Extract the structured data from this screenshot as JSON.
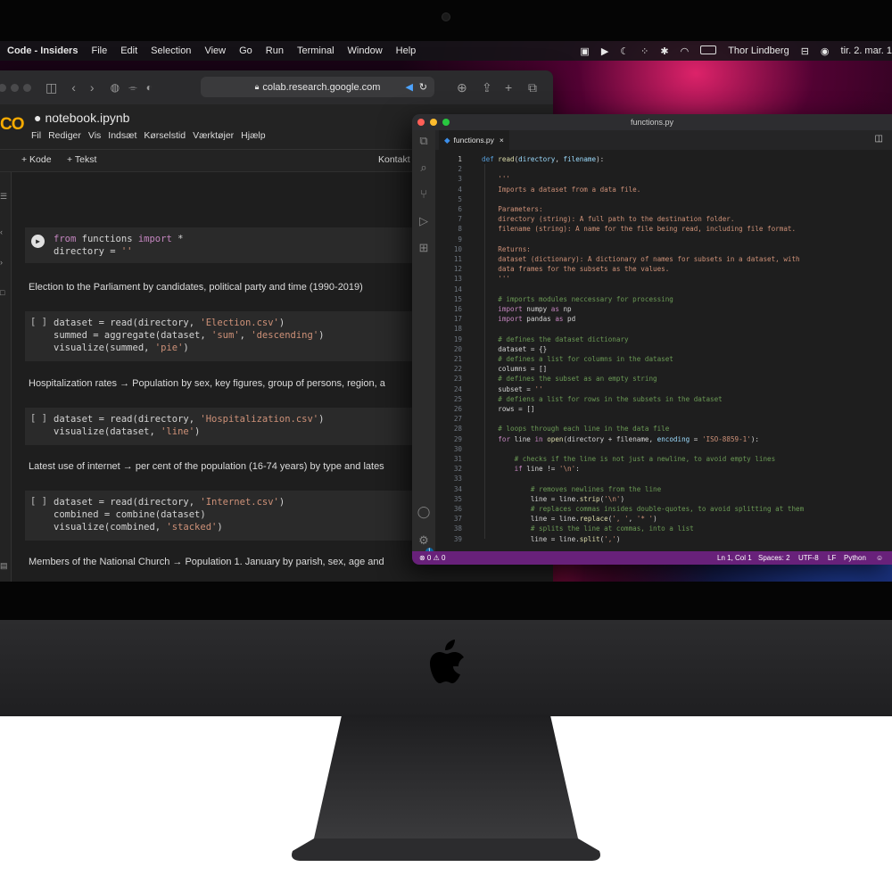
{
  "menubar": {
    "app_name": "Code - Insiders",
    "items": [
      "File",
      "Edit",
      "Selection",
      "View",
      "Go",
      "Run",
      "Terminal",
      "Window",
      "Help"
    ],
    "user": "Thor Lindberg",
    "datetime": "tir. 2. mar. 1"
  },
  "browser": {
    "url": "colab.research.google.com"
  },
  "colab": {
    "logo": "CO",
    "notebook_title": "notebook.ipynb",
    "menu": [
      "Fil",
      "Rediger",
      "Vis",
      "Indsæt",
      "Kørselstid",
      "Værktøjer",
      "Hjælp"
    ],
    "add_code": "+ Kode",
    "add_text": "+ Tekst",
    "contact": "Kontakt",
    "run_prompt": "[ ]",
    "cells": [
      {
        "type": "code",
        "lines": [
          [
            {
              "t": "from",
              "c": "k"
            },
            {
              "t": " functions ",
              "c": ""
            },
            {
              "t": "import",
              "c": "k"
            },
            {
              "t": " *",
              "c": ""
            }
          ],
          [
            {
              "t": "directory = ",
              "c": ""
            },
            {
              "t": "''",
              "c": "s"
            }
          ]
        ]
      },
      {
        "type": "markdown",
        "text": "Election to the Parliament by candidates, political party and time (1990-2019)"
      },
      {
        "type": "code",
        "lines": [
          [
            {
              "t": "dataset = read(directory, ",
              "c": ""
            },
            {
              "t": "'Election.csv'",
              "c": "s"
            },
            {
              "t": ")",
              "c": ""
            }
          ],
          [
            {
              "t": "summed = aggregate(dataset, ",
              "c": ""
            },
            {
              "t": "'sum'",
              "c": "s"
            },
            {
              "t": ", ",
              "c": ""
            },
            {
              "t": "'descending'",
              "c": "s"
            },
            {
              "t": ")",
              "c": ""
            }
          ],
          [
            {
              "t": "visualize(summed, ",
              "c": ""
            },
            {
              "t": "'pie'",
              "c": "s"
            },
            {
              "t": ")",
              "c": ""
            }
          ]
        ]
      },
      {
        "type": "markdown",
        "text": "Hospitalization rates → Population by sex, key figures, group of persons, region, a"
      },
      {
        "type": "code",
        "lines": [
          [
            {
              "t": "dataset = read(directory, ",
              "c": ""
            },
            {
              "t": "'Hospitalization.csv'",
              "c": "s"
            },
            {
              "t": ")",
              "c": ""
            }
          ],
          [
            {
              "t": "visualize(dataset, ",
              "c": ""
            },
            {
              "t": "'line'",
              "c": "s"
            },
            {
              "t": ")",
              "c": ""
            }
          ]
        ]
      },
      {
        "type": "markdown",
        "text": "Latest use of internet → per cent of the population (16-74 years) by type and lates"
      },
      {
        "type": "code",
        "lines": [
          [
            {
              "t": "dataset = read(directory, ",
              "c": ""
            },
            {
              "t": "'Internet.csv'",
              "c": "s"
            },
            {
              "t": ")",
              "c": ""
            }
          ],
          [
            {
              "t": "combined = combine(dataset)",
              "c": ""
            }
          ],
          [
            {
              "t": "visualize(combined, ",
              "c": ""
            },
            {
              "t": "'stacked'",
              "c": "s"
            },
            {
              "t": ")",
              "c": ""
            }
          ]
        ]
      },
      {
        "type": "markdown",
        "text": "Members of the National Church → Population 1. January by parish, sex, age and"
      }
    ]
  },
  "vscode": {
    "window_title": "functions.py",
    "tab_label": "functions.py",
    "code": [
      [
        {
          "t": "def",
          "c": "kw"
        },
        {
          "t": " ",
          "c": ""
        },
        {
          "t": "read",
          "c": "f"
        },
        {
          "t": "(",
          "c": ""
        },
        {
          "t": "directory",
          "c": "n"
        },
        {
          "t": ", ",
          "c": ""
        },
        {
          "t": "filename",
          "c": "n"
        },
        {
          "t": "):",
          "c": ""
        }
      ],
      [],
      [
        {
          "t": "    '''",
          "c": "s"
        }
      ],
      [
        {
          "t": "    Imports a dataset from a data file.",
          "c": "s"
        }
      ],
      [],
      [
        {
          "t": "    Parameters:",
          "c": "s"
        }
      ],
      [
        {
          "t": "    directory (string): A full path to the destination folder.",
          "c": "s"
        }
      ],
      [
        {
          "t": "    filename (string): A name for the file being read, including file format.",
          "c": "s"
        }
      ],
      [],
      [
        {
          "t": "    Returns:",
          "c": "s"
        }
      ],
      [
        {
          "t": "    dataset (dictionary): A dictionary of names for subsets in a dataset, with",
          "c": "s"
        }
      ],
      [
        {
          "t": "    data frames for the subsets as the values.",
          "c": "s"
        }
      ],
      [
        {
          "t": "    '''",
          "c": "s"
        }
      ],
      [],
      [
        {
          "t": "    # imports modules neccessary for processing",
          "c": "c"
        }
      ],
      [
        {
          "t": "    ",
          "c": ""
        },
        {
          "t": "import",
          "c": "k"
        },
        {
          "t": " numpy ",
          "c": ""
        },
        {
          "t": "as",
          "c": "k"
        },
        {
          "t": " np",
          "c": ""
        }
      ],
      [
        {
          "t": "    ",
          "c": ""
        },
        {
          "t": "import",
          "c": "k"
        },
        {
          "t": " pandas ",
          "c": ""
        },
        {
          "t": "as",
          "c": "k"
        },
        {
          "t": " pd",
          "c": ""
        }
      ],
      [],
      [
        {
          "t": "    # defines the dataset dictionary",
          "c": "c"
        }
      ],
      [
        {
          "t": "    dataset = {}",
          "c": ""
        }
      ],
      [
        {
          "t": "    # defines a list for columns in the dataset",
          "c": "c"
        }
      ],
      [
        {
          "t": "    columns = []",
          "c": ""
        }
      ],
      [
        {
          "t": "    # defines the subset as an empty string",
          "c": "c"
        }
      ],
      [
        {
          "t": "    subset = ",
          "c": ""
        },
        {
          "t": "''",
          "c": "s"
        }
      ],
      [
        {
          "t": "    # defiens a list for rows in the subsets in the dataset",
          "c": "c"
        }
      ],
      [
        {
          "t": "    rows = []",
          "c": ""
        }
      ],
      [],
      [
        {
          "t": "    # loops through each line in the data file",
          "c": "c"
        }
      ],
      [
        {
          "t": "    ",
          "c": ""
        },
        {
          "t": "for",
          "c": "k"
        },
        {
          "t": " line ",
          "c": ""
        },
        {
          "t": "in",
          "c": "k"
        },
        {
          "t": " ",
          "c": ""
        },
        {
          "t": "open",
          "c": "f"
        },
        {
          "t": "(directory + filename, ",
          "c": ""
        },
        {
          "t": "encoding",
          "c": "n"
        },
        {
          "t": " = ",
          "c": ""
        },
        {
          "t": "'ISO-8859-1'",
          "c": "s"
        },
        {
          "t": "):",
          "c": ""
        }
      ],
      [],
      [
        {
          "t": "        # checks if the line is not just a newline, to avoid empty lines",
          "c": "c"
        }
      ],
      [
        {
          "t": "        ",
          "c": ""
        },
        {
          "t": "if",
          "c": "k"
        },
        {
          "t": " line != ",
          "c": ""
        },
        {
          "t": "'\\n'",
          "c": "s"
        },
        {
          "t": ":",
          "c": ""
        }
      ],
      [],
      [
        {
          "t": "            # removes newlines from the line",
          "c": "c"
        }
      ],
      [
        {
          "t": "            line = line.",
          "c": ""
        },
        {
          "t": "strip",
          "c": "f"
        },
        {
          "t": "(",
          "c": ""
        },
        {
          "t": "'\\n'",
          "c": "s"
        },
        {
          "t": ")",
          "c": ""
        }
      ],
      [
        {
          "t": "            # replaces commas insides double-quotes, to avoid splitting at them",
          "c": "c"
        }
      ],
      [
        {
          "t": "            line = line.",
          "c": ""
        },
        {
          "t": "replace",
          "c": "f"
        },
        {
          "t": "(",
          "c": ""
        },
        {
          "t": "', '",
          "c": "s"
        },
        {
          "t": ", ",
          "c": ""
        },
        {
          "t": "'* '",
          "c": "s"
        },
        {
          "t": ")",
          "c": ""
        }
      ],
      [
        {
          "t": "            # splits the line at commas, into a list",
          "c": "c"
        }
      ],
      [
        {
          "t": "            line = line.",
          "c": ""
        },
        {
          "t": "split",
          "c": "f"
        },
        {
          "t": "(",
          "c": ""
        },
        {
          "t": "','",
          "c": "s"
        },
        {
          "t": ")",
          "c": ""
        }
      ]
    ],
    "status": {
      "problems": "⊗ 0 ⚠ 0",
      "position": "Ln 1, Col 1",
      "spaces": "Spaces: 2",
      "encoding": "UTF-8",
      "eol": "LF",
      "language": "Python"
    },
    "accounts_badge": "1"
  },
  "colors": {
    "statusbar": "#68217a",
    "colab_orange": "#f9ab00"
  }
}
